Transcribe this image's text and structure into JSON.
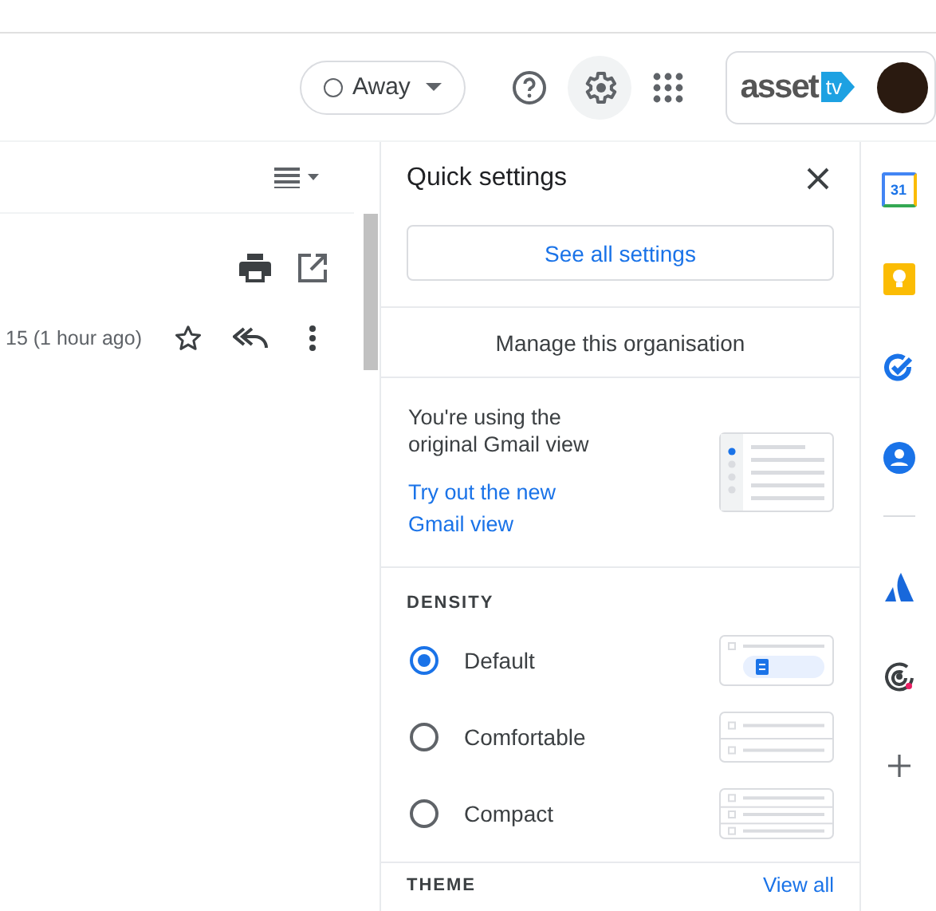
{
  "top_bar": {
    "status": {
      "label": "Away"
    },
    "account": {
      "logo_text": "asset",
      "logo_badge": "tv"
    }
  },
  "message": {
    "date": "15 (1 hour ago)",
    "starred": false
  },
  "quick_settings": {
    "title": "Quick settings",
    "see_all": "See all settings",
    "manage": "Manage this organisation",
    "view_notice": {
      "text": "You're using the original Gmail view",
      "link": "Try out the new Gmail view"
    },
    "density": {
      "heading": "DENSITY",
      "options": [
        {
          "kind": "default",
          "label": "Default",
          "selected": true
        },
        {
          "kind": "comfortable",
          "label": "Comfortable",
          "selected": false
        },
        {
          "kind": "compact",
          "label": "Compact",
          "selected": false
        }
      ]
    },
    "theme": {
      "heading": "THEME",
      "link": "View all"
    }
  },
  "side_apps": [
    {
      "kind": "calendar",
      "label": "31"
    },
    {
      "kind": "keep"
    },
    {
      "kind": "tasks"
    },
    {
      "kind": "contacts"
    },
    {
      "kind": "divider"
    },
    {
      "kind": "atlassian"
    },
    {
      "kind": "radar"
    },
    {
      "kind": "add"
    }
  ]
}
